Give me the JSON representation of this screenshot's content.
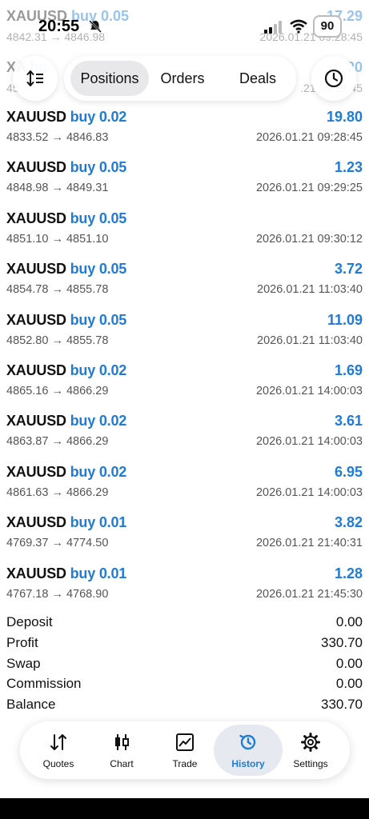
{
  "status_bar": {
    "time": "20:55",
    "battery": "90"
  },
  "background_rows": [
    {
      "symbol": "XAUUSD",
      "side": "buy 0.05",
      "prices": "4842.31 → 4846.98",
      "profit": "17.29",
      "time": "2026.01.21 09:28:45"
    },
    {
      "symbol": "XA",
      "side": "bu",
      "prices": "45",
      "profit": "20",
      "time": ".21 09:28:45"
    }
  ],
  "top_bar": {
    "sort_icon": "sort-icon",
    "history_icon": "clock-icon",
    "tabs": [
      {
        "label": "Positions",
        "active": true
      },
      {
        "label": "Orders",
        "active": false
      },
      {
        "label": "Deals",
        "active": false
      }
    ]
  },
  "deals": [
    {
      "symbol": "XAUUSD",
      "side": "buy 0.02",
      "prices": "4833.52 → 4846.83",
      "profit": "19.80",
      "time": "2026.01.21 09:28:45"
    },
    {
      "symbol": "XAUUSD",
      "side": "buy 0.05",
      "prices": "4848.98 → 4849.31",
      "profit": "1.23",
      "time": "2026.01.21 09:29:25"
    },
    {
      "symbol": "XAUUSD",
      "side": "buy 0.05",
      "prices": "4851.10 → 4851.10",
      "profit": "",
      "time": "2026.01.21 09:30:12"
    },
    {
      "symbol": "XAUUSD",
      "side": "buy 0.05",
      "prices": "4854.78 → 4855.78",
      "profit": "3.72",
      "time": "2026.01.21 11:03:40"
    },
    {
      "symbol": "XAUUSD",
      "side": "buy 0.05",
      "prices": "4852.80 → 4855.78",
      "profit": "11.09",
      "time": "2026.01.21 11:03:40"
    },
    {
      "symbol": "XAUUSD",
      "side": "buy 0.02",
      "prices": "4865.16 → 4866.29",
      "profit": "1.69",
      "time": "2026.01.21 14:00:03"
    },
    {
      "symbol": "XAUUSD",
      "side": "buy 0.02",
      "prices": "4863.87 → 4866.29",
      "profit": "3.61",
      "time": "2026.01.21 14:00:03"
    },
    {
      "symbol": "XAUUSD",
      "side": "buy 0.02",
      "prices": "4861.63 → 4866.29",
      "profit": "6.95",
      "time": "2026.01.21 14:00:03"
    },
    {
      "symbol": "XAUUSD",
      "side": "buy 0.01",
      "prices": "4769.37 → 4774.50",
      "profit": "3.82",
      "time": "2026.01.21 21:40:31"
    },
    {
      "symbol": "XAUUSD",
      "side": "buy 0.01",
      "prices": "4767.18 → 4768.90",
      "profit": "1.28",
      "time": "2026.01.21 21:45:30"
    }
  ],
  "summary": [
    {
      "label": "Deposit",
      "value": "0.00"
    },
    {
      "label": "Profit",
      "value": "330.70"
    },
    {
      "label": "Swap",
      "value": "0.00"
    },
    {
      "label": "Commission",
      "value": "0.00"
    },
    {
      "label": "Balance",
      "value": "330.70"
    }
  ],
  "tab_bar": {
    "tabs": [
      {
        "label": "Quotes",
        "icon": "quotes-icon",
        "active": false
      },
      {
        "label": "Chart",
        "icon": "candlestick-icon",
        "active": false
      },
      {
        "label": "Trade",
        "icon": "trade-chart-icon",
        "active": false
      },
      {
        "label": "History",
        "icon": "history-icon",
        "active": true
      },
      {
        "label": "Settings",
        "icon": "gear-icon",
        "active": false
      }
    ]
  },
  "colors": {
    "accent": "#1e7bd6",
    "text": "#111111",
    "muted": "#555555",
    "active_pill": "#e8e8ea"
  }
}
